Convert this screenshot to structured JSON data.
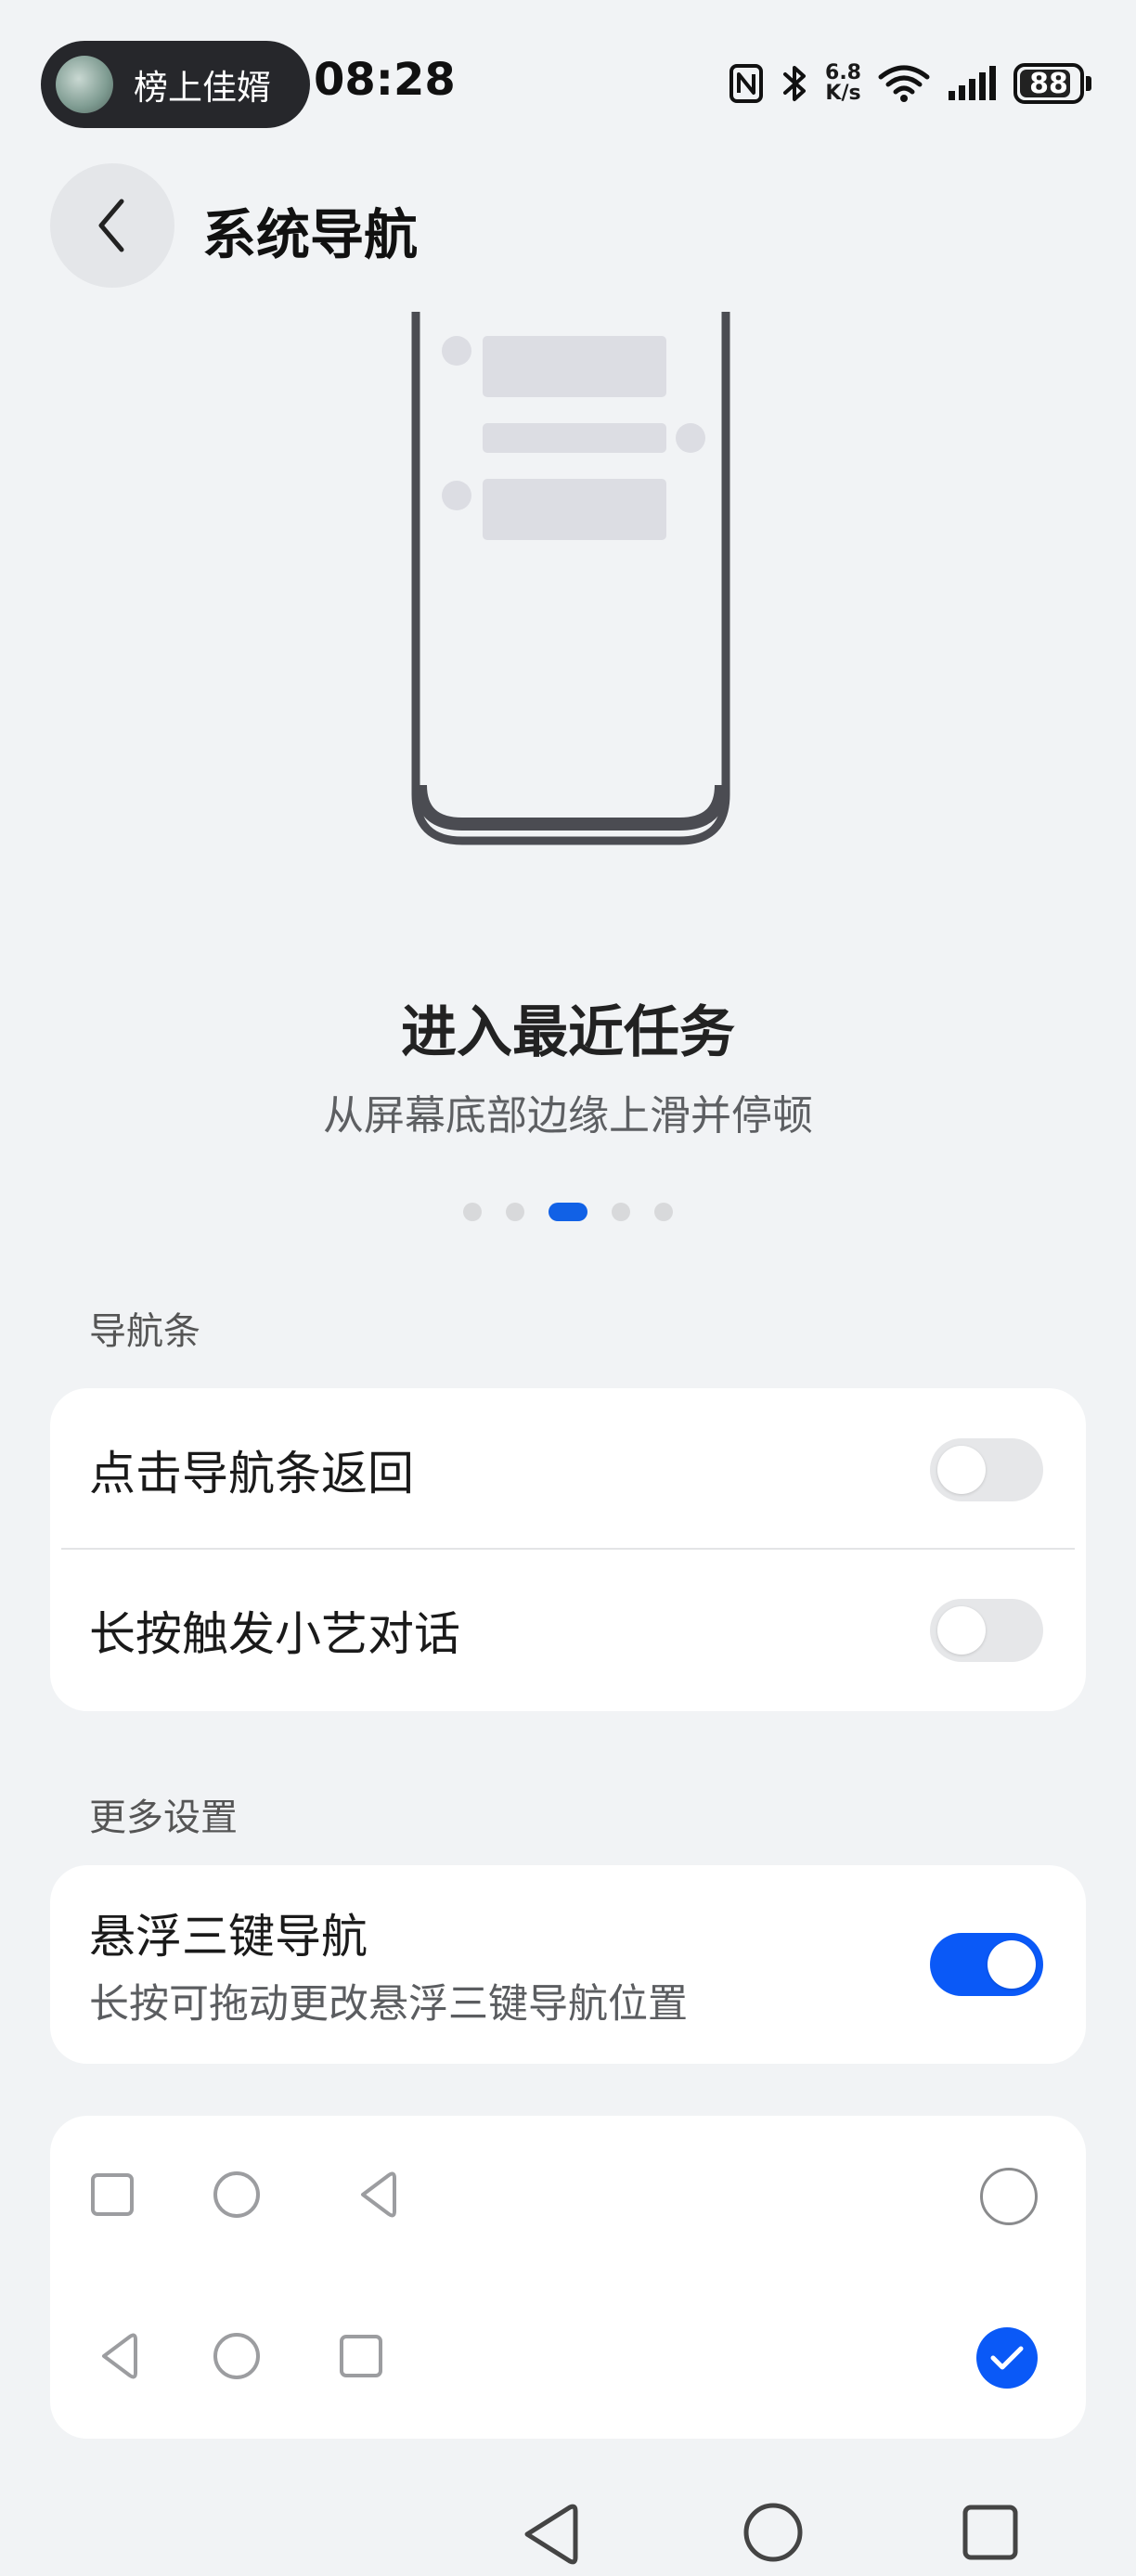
{
  "status_bar": {
    "user_name": "榜上佳婿",
    "time": "08:28",
    "net_speed_value": "6.8",
    "net_speed_unit": "K/s",
    "battery": "88",
    "battery_level": 0.88,
    "icons": [
      "nfc-icon",
      "bluetooth-icon",
      "wifi-icon",
      "signal-icon",
      "battery-icon"
    ]
  },
  "header": {
    "title": "系统导航"
  },
  "guide": {
    "title": "进入最近任务",
    "subtitle": "从屏幕底部边缘上滑并停顿",
    "page_count": 5,
    "current_page": 3
  },
  "nav_bar_section": {
    "label": "导航条",
    "items": [
      {
        "label": "点击导航条返回",
        "enabled": false
      },
      {
        "label": "长按触发小艺对话",
        "enabled": false
      }
    ]
  },
  "more_section": {
    "label": "更多设置",
    "floating": {
      "label": "悬浮三键导航",
      "description": "长按可拖动更改悬浮三键导航位置",
      "enabled": true
    },
    "layouts": [
      {
        "order": [
          "square",
          "circle",
          "triangle"
        ],
        "selected": false
      },
      {
        "order": [
          "triangle",
          "circle",
          "square"
        ],
        "selected": true
      }
    ]
  },
  "colors": {
    "accent": "#0a59f7",
    "background": "#f1f3f5",
    "card": "#ffffff"
  }
}
